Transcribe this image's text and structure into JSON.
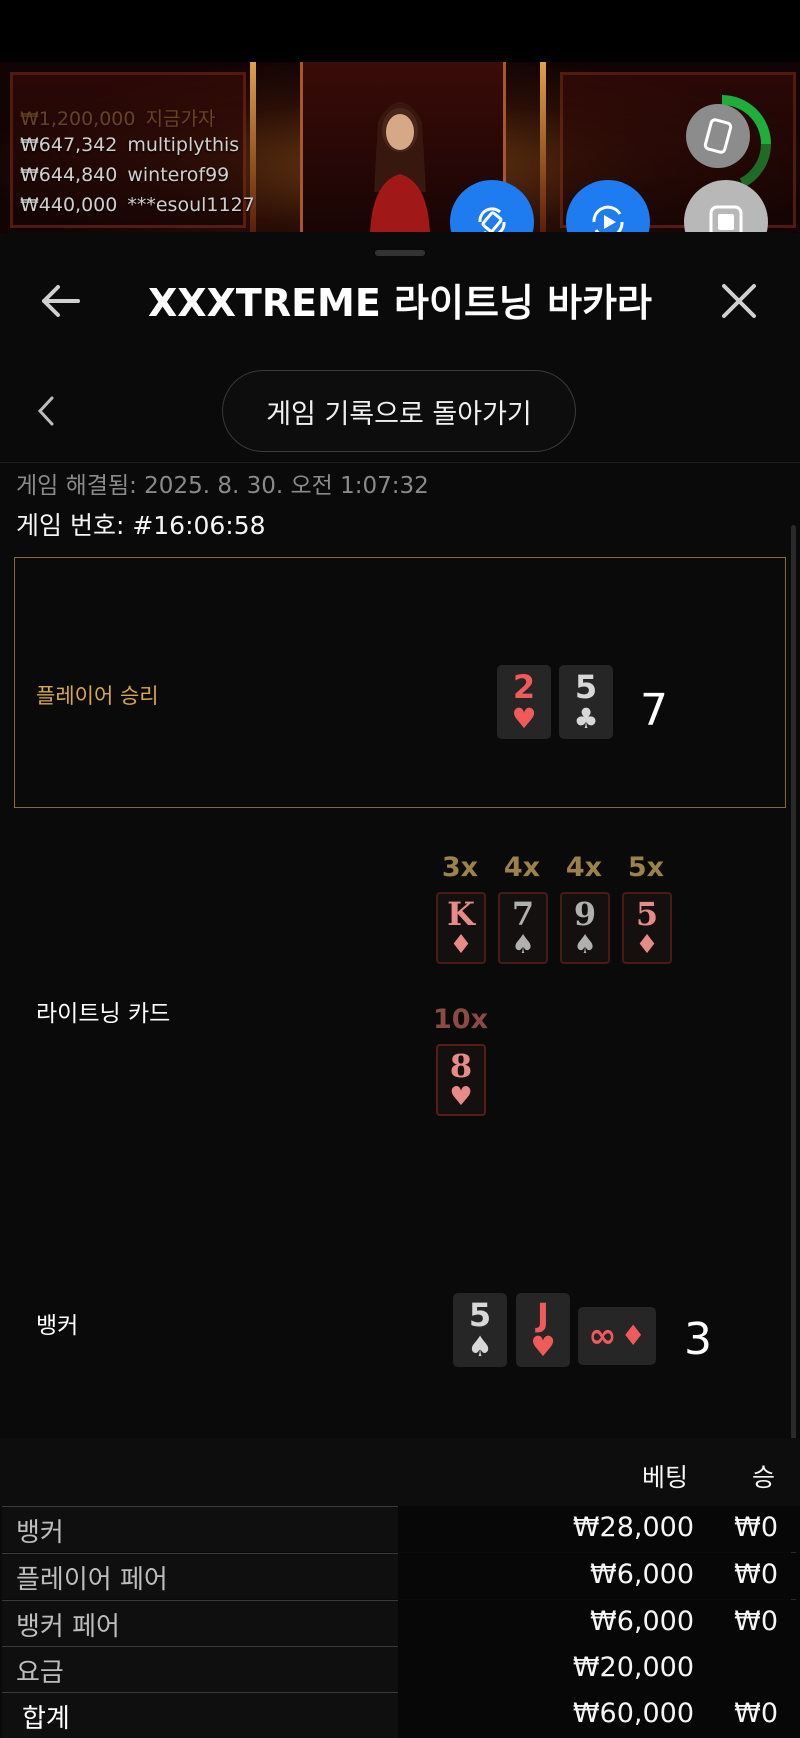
{
  "leaderboard": [
    {
      "amount": "₩1,200,000",
      "name": "지금가자",
      "faded": true
    },
    {
      "amount": "₩647,342",
      "name": "multiplythis"
    },
    {
      "amount": "₩644,840",
      "name": "winterof99"
    },
    {
      "amount": "₩440,000",
      "name": "***esoul1127"
    }
  ],
  "header": {
    "title": "XXXTREME 라이트닝 바카라"
  },
  "nav": {
    "back_to_history": "게임 기록으로 돌아가기"
  },
  "game": {
    "resolved": "게임 해결됨: 2025. 8. 30. 오전 1:07:32",
    "number": "게임 번호: #16:06:58"
  },
  "player": {
    "label": "플레이어 승리",
    "cards": [
      {
        "rank": "2",
        "suit": "♥",
        "color": "red"
      },
      {
        "rank": "5",
        "suit": "♣",
        "color": "white"
      }
    ],
    "score": "7"
  },
  "lightning": {
    "label": "라이트닝 카드",
    "cards": [
      {
        "mult": "3x",
        "rank": "K",
        "suit": "♦",
        "color": "pink"
      },
      {
        "mult": "4x",
        "rank": "7",
        "suit": "♠",
        "color": "grey"
      },
      {
        "mult": "4x",
        "rank": "9",
        "suit": "♠",
        "color": "grey"
      },
      {
        "mult": "5x",
        "rank": "5",
        "suit": "♦",
        "color": "pink"
      },
      {
        "mult": "10x",
        "rank": "8",
        "suit": "♥",
        "color": "pink"
      }
    ]
  },
  "banker": {
    "label": "뱅커",
    "cards": [
      {
        "rank": "5",
        "suit": "♠",
        "color": "white"
      },
      {
        "rank": "J",
        "suit": "♥",
        "color": "red"
      }
    ],
    "extra_card": {
      "rank": "∞",
      "suit": "♦"
    },
    "score": "3"
  },
  "bets_table": {
    "headers": {
      "bet": "베팅",
      "win": "승"
    },
    "rows": [
      {
        "name": "뱅커",
        "bet": "₩28,000",
        "win": "₩0"
      },
      {
        "name": "플레이어 페어",
        "bet": "₩6,000",
        "win": "₩0"
      },
      {
        "name": "뱅커 페어",
        "bet": "₩6,000",
        "win": "₩0"
      },
      {
        "name": "요금",
        "bet": "₩20,000",
        "win": ""
      }
    ],
    "total": {
      "name": "합계",
      "bet": "₩60,000",
      "win": "₩0"
    }
  },
  "colors": {
    "accent_gold": "#d8a74a",
    "float_blue": "#1e7cf0",
    "float_grey": "#b8b8b8",
    "progress_green": "#1fae3a"
  }
}
